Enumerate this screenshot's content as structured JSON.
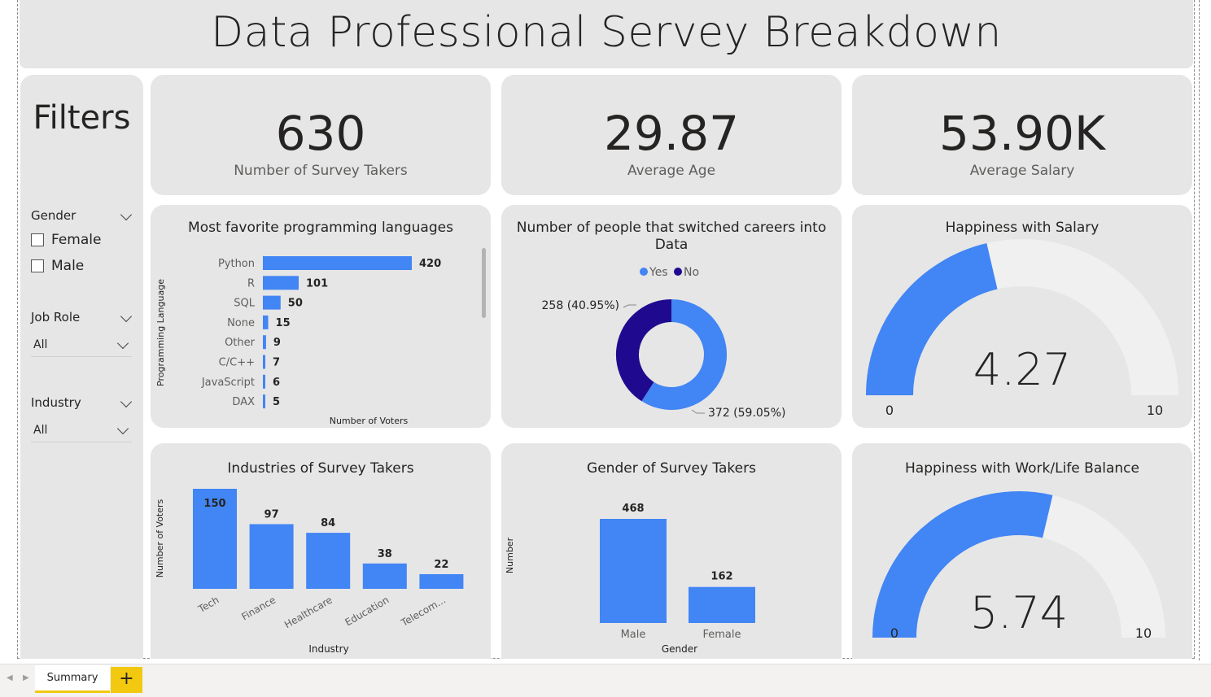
{
  "title": "Data Professional Servey Breakdown",
  "filters": {
    "heading": "Filters",
    "gender": {
      "label": "Gender",
      "options": [
        "Female",
        "Male"
      ]
    },
    "job_role": {
      "label": "Job Role",
      "value": "All"
    },
    "industry": {
      "label": "Industry",
      "value": "All"
    }
  },
  "kpis": [
    {
      "value": "630",
      "label": "Number of Survey Takers"
    },
    {
      "value": "29.87",
      "label": "Average Age"
    },
    {
      "value": "53.90K",
      "label": "Average Salary"
    }
  ],
  "colors": {
    "accent": "#4285f4",
    "dark": "#1f0a8f",
    "card": "#e6e6e6",
    "gauge_track": "#f0f0f0",
    "tab_accent": "#f2c811"
  },
  "tabs": {
    "active": "Summary",
    "add": "+"
  },
  "chart_data": [
    {
      "type": "bar",
      "orientation": "horizontal",
      "title": "Most favorite programming languages",
      "xlabel": "Number of Voters",
      "ylabel": "Programming Language",
      "categories": [
        "Python",
        "R",
        "SQL",
        "None",
        "Other",
        "C/C++",
        "JavaScript",
        "DAX"
      ],
      "values": [
        420,
        101,
        50,
        15,
        9,
        7,
        6,
        5
      ]
    },
    {
      "type": "pie",
      "subtype": "donut",
      "title": "Number of people that switched careers into Data",
      "legend": [
        "Yes",
        "No"
      ],
      "legend_position": "top",
      "slices": [
        {
          "name": "Yes",
          "value": 372,
          "label": "372 (59.05%)"
        },
        {
          "name": "No",
          "value": 258,
          "label": "258 (40.95%)"
        }
      ]
    },
    {
      "type": "gauge",
      "title": "Happiness with Salary",
      "value": 4.27,
      "display": "4.27",
      "min": 0,
      "max": 10,
      "min_label": "0",
      "max_label": "10"
    },
    {
      "type": "bar",
      "title": "Industries of Survey Takers",
      "xlabel": "Industry",
      "ylabel": "Number of Voters",
      "categories": [
        "Tech",
        "Finance",
        "Healthcare",
        "Education",
        "Telecom..."
      ],
      "values": [
        150,
        97,
        84,
        38,
        22
      ]
    },
    {
      "type": "bar",
      "title": "Gender of Survey Takers",
      "xlabel": "Gender",
      "ylabel": "Number",
      "categories": [
        "Male",
        "Female"
      ],
      "values": [
        468,
        162
      ]
    },
    {
      "type": "gauge",
      "title": "Happiness with Work/Life Balance",
      "value": 5.74,
      "display": "5.74",
      "min": 0,
      "max": 10,
      "min_label": "0",
      "max_label": "10"
    }
  ]
}
